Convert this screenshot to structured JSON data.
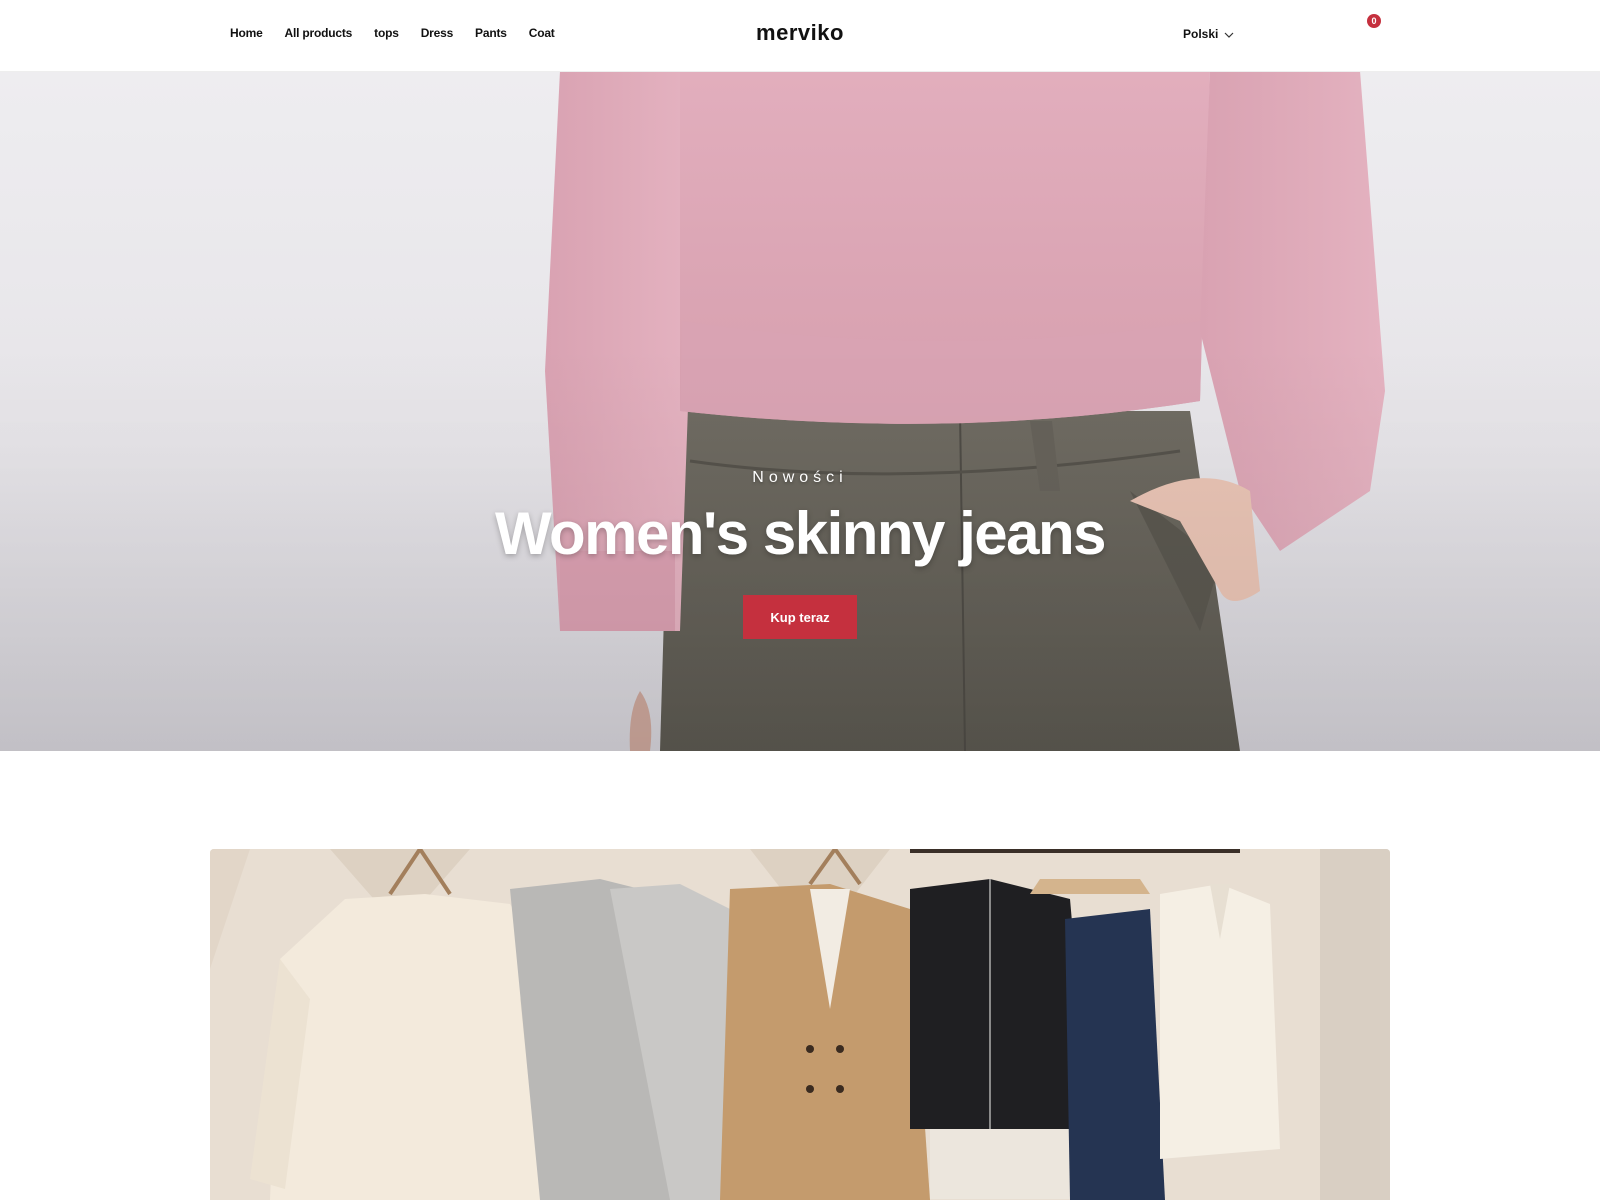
{
  "header": {
    "nav": [
      "Home",
      "All products",
      "tops",
      "Dress",
      "Pants",
      "Coat"
    ],
    "logo": "merviko",
    "language": "Polski",
    "cart_count": "0",
    "icons": [
      "chevron-down-icon",
      "shopping-bag-icon"
    ],
    "accent_color": "#c5303e"
  },
  "hero": {
    "subtitle": "Nowości",
    "title": "Women's skinny jeans",
    "button": "Kup teraz"
  },
  "banner": {
    "description_items": [
      "cream knit sweater",
      "grey sweatshirts",
      "beige trench coat",
      "black jacket",
      "dark jeans",
      "white shirt"
    ]
  }
}
